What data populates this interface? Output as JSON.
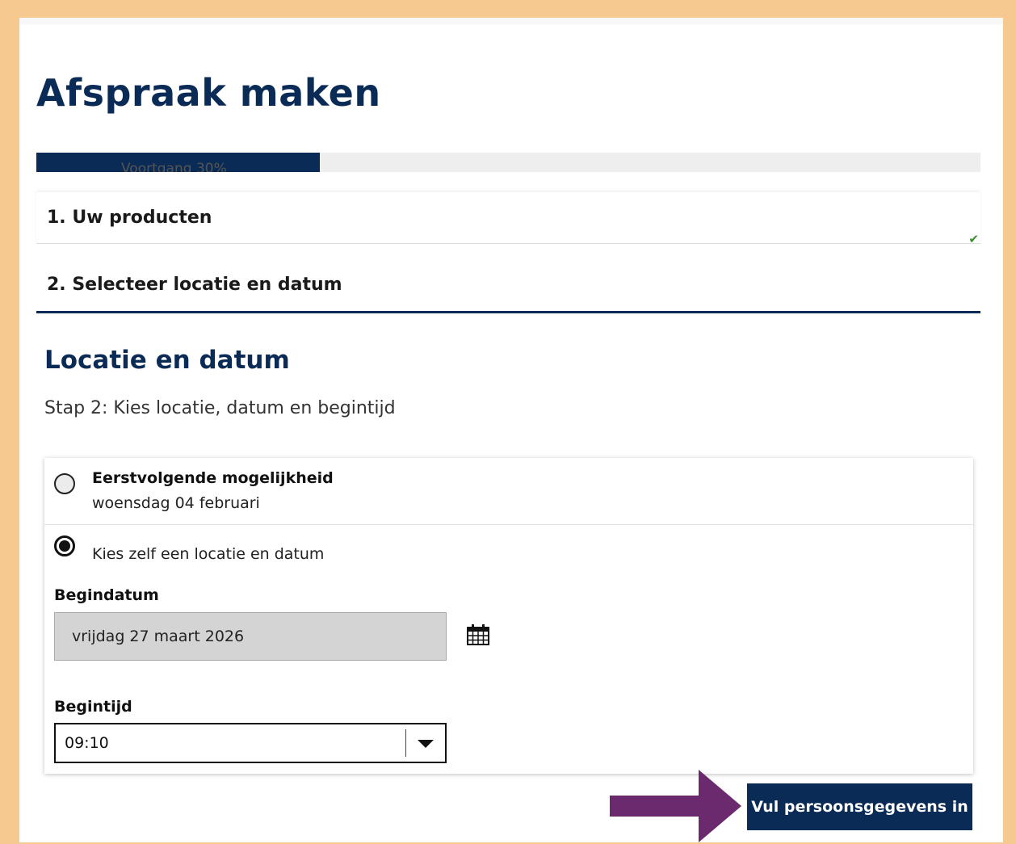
{
  "page": {
    "title": "Afspraak maken",
    "progress": {
      "label": "Voortgang 30%",
      "percent": 30
    }
  },
  "steps": [
    {
      "label": "1. Uw producten",
      "completed_icon": "check-icon"
    },
    {
      "label": "2. Selecteer locatie en datum"
    }
  ],
  "section": {
    "title": "Locatie en datum",
    "subtitle": "Stap 2: Kies locatie, datum en begintijd"
  },
  "options": {
    "first_available": {
      "title": "Eerstvolgende mogelijkheid",
      "date": "woensdag 04 februari",
      "selected": false
    },
    "choose_self": {
      "label": "Kies zelf een locatie en datum",
      "selected": true
    }
  },
  "form": {
    "start_date": {
      "label": "Begindatum",
      "value": "vrijdag 27 maart 2026",
      "icon": "calendar-icon"
    },
    "start_time": {
      "label": "Begintijd",
      "value": "09:10",
      "icon": "caret-down-icon"
    }
  },
  "actions": {
    "next_label": "Vul persoonsgegevens in"
  },
  "colors": {
    "primary": "#0b2b57",
    "frame": "#f5c98f",
    "arrow": "#6b2a6e",
    "check": "#3a8a2e"
  }
}
